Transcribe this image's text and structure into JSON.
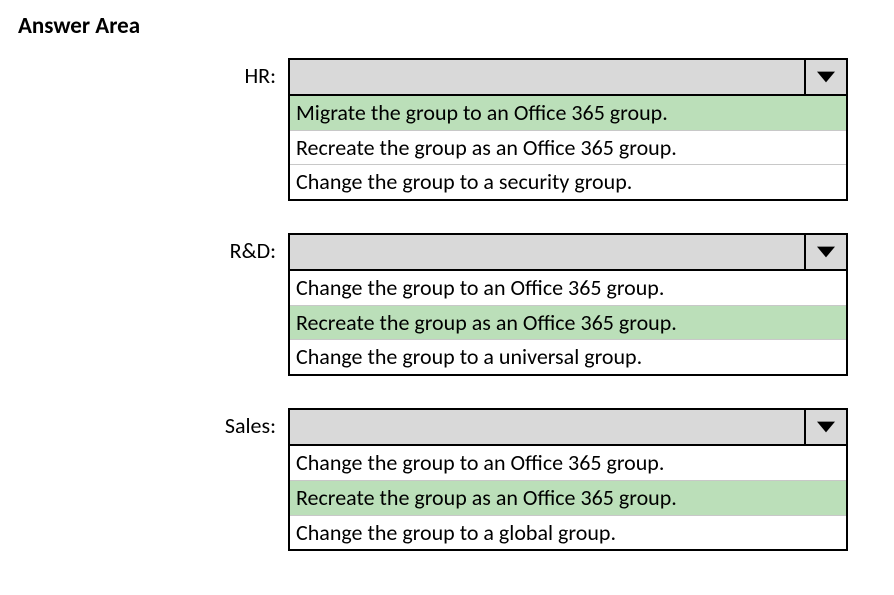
{
  "title": "Answer Area",
  "groups": [
    {
      "label": "HR:",
      "options": [
        {
          "text": "Migrate the group to an Office 365 group.",
          "selected": true
        },
        {
          "text": "Recreate the group as an Office 365 group.",
          "selected": false
        },
        {
          "text": "Change the group to a security group.",
          "selected": false
        }
      ]
    },
    {
      "label": "R&D:",
      "options": [
        {
          "text": "Change the group to an Office 365 group.",
          "selected": false
        },
        {
          "text": "Recreate the group as an Office 365 group.",
          "selected": true
        },
        {
          "text": "Change the group to a universal group.",
          "selected": false
        }
      ]
    },
    {
      "label": "Sales:",
      "options": [
        {
          "text": "Change the group to an Office 365 group.",
          "selected": false
        },
        {
          "text": "Recreate the group as an Office 365 group.",
          "selected": true
        },
        {
          "text": "Change the group to a global group.",
          "selected": false
        }
      ]
    }
  ]
}
